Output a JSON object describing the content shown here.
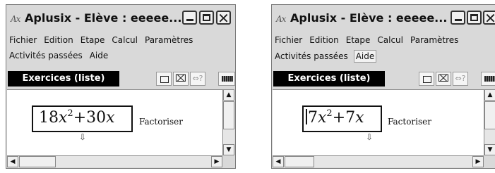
{
  "windows": [
    {
      "title": "Aplusix - Elève  : eeeee...",
      "icon": "Ax",
      "menu_row1": [
        "Fichier",
        "Edition",
        "Etape",
        "Calcul",
        "Paramètres"
      ],
      "menu_row2": [
        "Activités passées",
        "Aide"
      ],
      "toolbar_label": "Exercices (liste)",
      "expression": {
        "coef1": "18",
        "var": "x",
        "exp": "2",
        "op": "+",
        "coef2": "30",
        "var2": "x"
      },
      "task": "Factoriser",
      "cursor_in_expression": false
    },
    {
      "title": "Aplusix - Elève  : eeeee...",
      "icon": "Ax",
      "menu_row1": [
        "Fichier",
        "Edition",
        "Etape",
        "Calcul",
        "Paramètres"
      ],
      "menu_row2": [
        "Activités passées",
        "Aide"
      ],
      "active_menu": "Aide",
      "toolbar_label": "Exercices (liste)",
      "expression": {
        "coef1": "7",
        "var": "x",
        "exp": "2",
        "op": "+",
        "coef2": "7",
        "var2": "x"
      },
      "task": "Factoriser",
      "cursor_in_expression": true
    }
  ],
  "icons": {
    "minimize": "minimize-icon",
    "maximize": "maximize-icon",
    "close": "close-icon",
    "rect_tool": "rectangle-icon",
    "crossed_rect_tool": "crossed-rectangle-icon",
    "implies_tool": "equivalence-question-icon",
    "keyboard_tool": "keyboard-icon",
    "mouse_cursor": "mouse-pointer-icon"
  },
  "colors": {
    "window_bg": "#d9d9d9",
    "toolbar_label_bg": "#000000",
    "content_bg": "#ffffff"
  }
}
